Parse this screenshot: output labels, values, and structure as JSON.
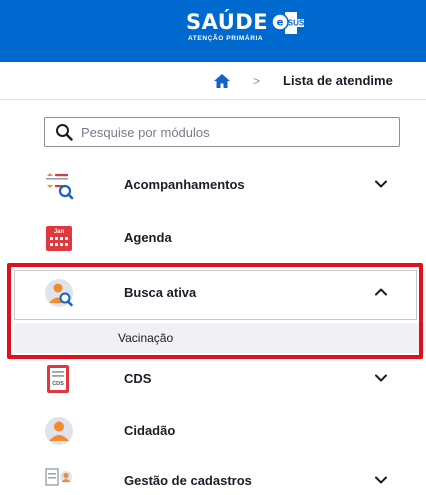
{
  "header": {
    "logo_main": "SAÚDE",
    "logo_sub": "ATENÇÃO PRIMÁRIA",
    "logo_badge": "SUS",
    "brand_color": "#0069d0"
  },
  "breadcrumb": {
    "home_icon": "home-icon",
    "separator": ">",
    "current": "Lista de atendime"
  },
  "search": {
    "placeholder": "Pesquise por módulos",
    "value": ""
  },
  "menu": {
    "items": [
      {
        "label": "Acompanhamentos",
        "icon": "acompanhamentos-icon",
        "has_chevron": true,
        "expanded": false
      },
      {
        "label": "Agenda",
        "icon": "calendar-icon",
        "icon_text": "Jan",
        "has_chevron": false
      },
      {
        "label": "Busca ativa",
        "icon": "busca-ativa-icon",
        "has_chevron": true,
        "expanded": true
      },
      {
        "label": "CDS",
        "icon": "cds-icon",
        "icon_text": "CDS",
        "has_chevron": true,
        "expanded": false
      },
      {
        "label": "Cidadão",
        "icon": "citizen-icon",
        "has_chevron": false
      },
      {
        "label": "Gestão de cadastros",
        "icon": "gestao-cadastros-icon",
        "has_chevron": true,
        "expanded": false
      }
    ],
    "busca_ativa_sub": [
      {
        "label": "Vacinação"
      }
    ]
  },
  "colors": {
    "highlight": "#e3101b",
    "accent_red": "#e0383e",
    "accent_orange": "#f28b30",
    "accent_blue": "#1560c9"
  }
}
